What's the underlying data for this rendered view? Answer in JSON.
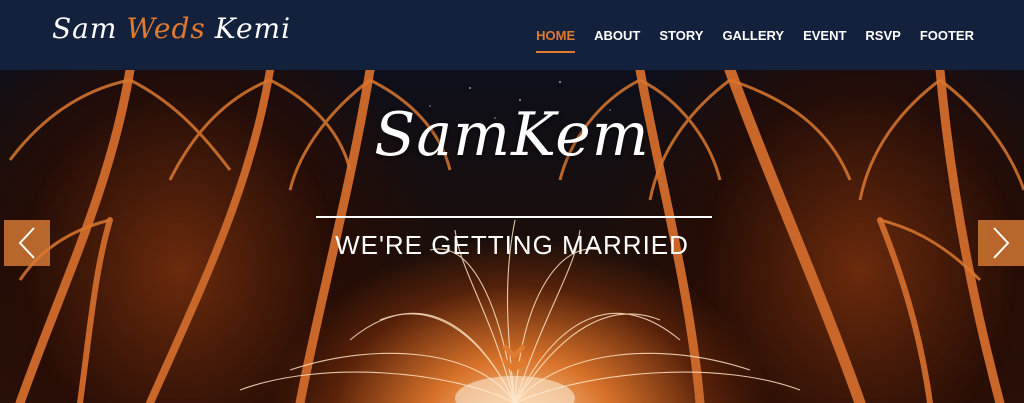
{
  "brand": {
    "part1": "Sam",
    "part2": "Weds",
    "part3": "Kemi"
  },
  "nav": {
    "items": [
      {
        "label": "HOME",
        "active": true
      },
      {
        "label": "ABOUT"
      },
      {
        "label": "STORY"
      },
      {
        "label": "GALLERY"
      },
      {
        "label": "EVENT"
      },
      {
        "label": "RSVP"
      },
      {
        "label": "FOOTER"
      }
    ]
  },
  "hero": {
    "title": "SamKem",
    "subtitle": "WE'RE GETTING MARRIED",
    "prev_icon": "chevron-left-icon",
    "next_icon": "chevron-right-icon",
    "scroll_icon": "double-chevron-down-icon"
  },
  "colors": {
    "navbar": "#14213d",
    "accent": "#e07a2e",
    "text": "#ffffff"
  }
}
